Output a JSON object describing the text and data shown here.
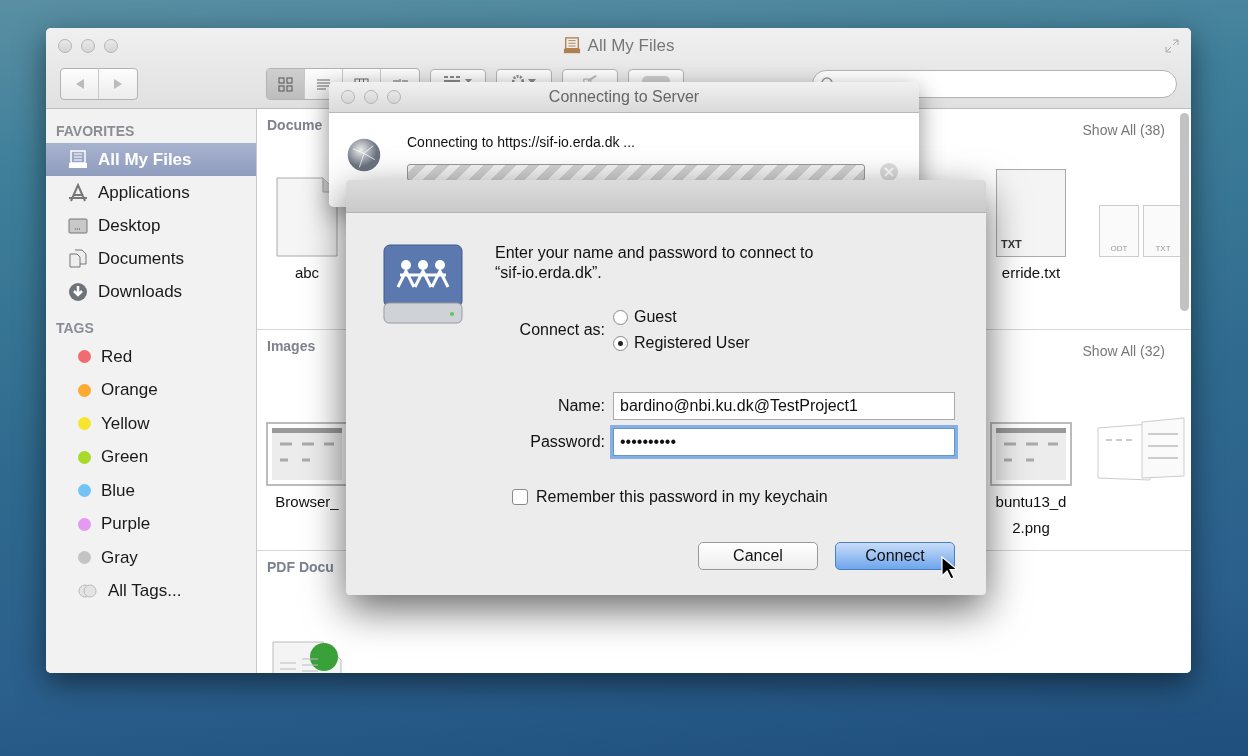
{
  "finder": {
    "title": "All My Files",
    "view_modes": [
      {
        "kind": "icon",
        "selected": true
      },
      {
        "kind": "list",
        "selected": false
      },
      {
        "kind": "column",
        "selected": false
      },
      {
        "kind": "coverflow",
        "selected": false
      }
    ],
    "sidebar": {
      "favorites_heading": "FAVORITES",
      "favorites": [
        {
          "label": "All My Files",
          "kind": "all-files",
          "selected": true
        },
        {
          "label": "Applications",
          "kind": "applications",
          "selected": false
        },
        {
          "label": "Desktop",
          "kind": "desktop",
          "selected": false
        },
        {
          "label": "Documents",
          "kind": "documents",
          "selected": false
        },
        {
          "label": "Downloads",
          "kind": "downloads",
          "selected": false
        }
      ],
      "tags_heading": "TAGS",
      "tags": [
        {
          "label": "Red",
          "kind": "tag",
          "color": "#f26b6e"
        },
        {
          "label": "Orange",
          "kind": "tag",
          "color": "#fbab31"
        },
        {
          "label": "Yellow",
          "kind": "tag",
          "color": "#f5e52c"
        },
        {
          "label": "Green",
          "kind": "tag",
          "color": "#a7da2b"
        },
        {
          "label": "Blue",
          "kind": "tag",
          "color": "#74c3f5"
        },
        {
          "label": "Purple",
          "kind": "tag",
          "color": "#e39af0"
        },
        {
          "label": "Gray",
          "kind": "tag",
          "color": "#c4c4c4"
        },
        {
          "label": "All Tags...",
          "kind": "all"
        }
      ]
    },
    "sections": [
      {
        "title": "Docume",
        "show_all": "Show All (38)",
        "files_left": [
          {
            "kind": "document",
            "label": [
              "abc"
            ]
          }
        ],
        "files_right": [
          {
            "kind": "text-file",
            "badge": "TXT",
            "label": [
              "erride.txt"
            ]
          },
          {
            "kind": "file-stack",
            "badges": [
              "ODT",
              "TXT"
            ]
          }
        ]
      },
      {
        "title": "Images",
        "show_all": "Show All (32)",
        "files_left": [
          {
            "kind": "screenshot",
            "label": [
              "Browser_"
            ]
          }
        ],
        "files_right": [
          {
            "kind": "screenshot",
            "label": [
              "buntu13_d",
              "2.png"
            ]
          },
          {
            "kind": "screenshot-stack"
          }
        ]
      },
      {
        "title": "PDF Docu",
        "files_left": [
          {
            "kind": "pdf"
          }
        ]
      }
    ]
  },
  "connecting": {
    "title": "Connecting to Server",
    "message": "Connecting to https://sif-io.erda.dk ...",
    "indeterminate": true
  },
  "login": {
    "prompt": "Enter your name and password to connect to “sif-io.erda.dk”.",
    "connect_as_label": "Connect as:",
    "options": [
      {
        "label": "Guest",
        "selected": false
      },
      {
        "label": "Registered User",
        "selected": true
      }
    ],
    "name_label": "Name:",
    "name_value": "bardino@nbi.ku.dk@TestProject1",
    "password_label": "Password:",
    "password_value": "••••••••••",
    "password_focused": true,
    "remember": {
      "label": "Remember this password in my keychain",
      "checked": false
    },
    "buttons": [
      {
        "label": "Cancel",
        "default": false
      },
      {
        "label": "Connect",
        "default": true
      }
    ]
  }
}
